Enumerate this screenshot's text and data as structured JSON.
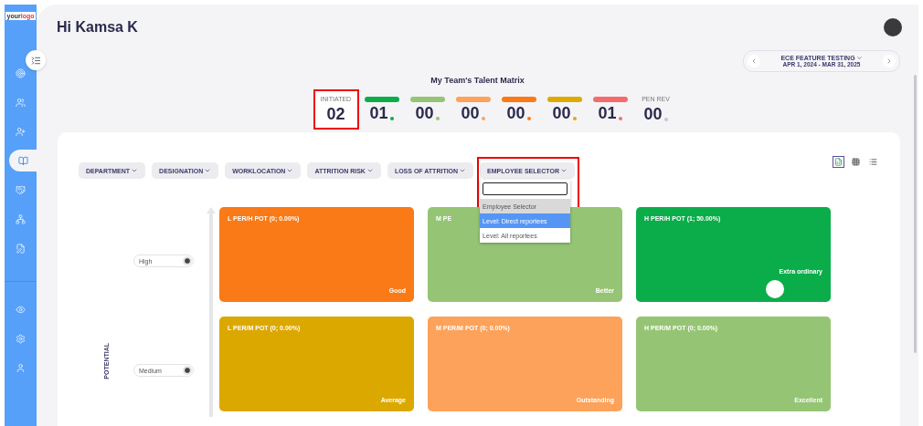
{
  "logo": {
    "first": "your",
    "second": "logo"
  },
  "sidebar": {
    "top_items": [
      {
        "selected": false
      },
      {
        "selected": false
      },
      {
        "selected": false
      },
      {
        "selected": true
      },
      {
        "selected": false
      },
      {
        "selected": false
      },
      {
        "selected": false
      }
    ],
    "bottom_items": [
      {
        "selected": false
      },
      {
        "selected": false
      },
      {
        "selected": false
      }
    ]
  },
  "header": {
    "greeting": "Hi Kamsa K"
  },
  "period": {
    "title": "ECE FEATURE TESTING",
    "dates": "APR 1, 2024 - MAR 31, 2025"
  },
  "matrix_title": "My Team's Talent Matrix",
  "stats": [
    {
      "label": "INITIATED",
      "value": "02",
      "highlighted": true
    },
    {
      "color": "#0bad4a",
      "value": "01",
      "highlighted": false
    },
    {
      "color": "#95c574",
      "value": "00",
      "highlighted": false
    },
    {
      "color": "#fca25a",
      "value": "00",
      "highlighted": false
    },
    {
      "color": "#f97a17",
      "value": "00",
      "highlighted": false
    },
    {
      "color": "#dcaa00",
      "value": "00",
      "highlighted": false
    },
    {
      "color": "#f56b6b",
      "value": "01",
      "highlighted": false
    },
    {
      "label": "PEN REV",
      "color": "#c8c8cc",
      "value": "00",
      "highlighted": false
    }
  ],
  "filters": [
    {
      "label": "DEPARTMENT",
      "expanded": false
    },
    {
      "label": "DESIGNATION",
      "expanded": false
    },
    {
      "label": "WORKLOCATION",
      "expanded": false
    },
    {
      "label": "ATTRITION RISK",
      "expanded": false
    },
    {
      "label": "LOSS OF ATTRITION",
      "expanded": false
    },
    {
      "label": "EMPLOYEE SELECTOR",
      "expanded": true
    }
  ],
  "dropdown": {
    "options": [
      {
        "label": "Employee Selector",
        "selected": false,
        "disabled": true
      },
      {
        "label": "Level: Direct reportees",
        "selected": true,
        "disabled": false
      },
      {
        "label": "Level: All reportees",
        "selected": false,
        "disabled": false
      }
    ]
  },
  "view_options": [
    {
      "selected": true
    },
    {
      "selected": false
    },
    {
      "selected": false
    }
  ],
  "y_axis_label": "POTENTIAL",
  "rows": [
    {
      "level": "High",
      "cells": [
        {
          "title": "L PER/H POT (0; 0.00%)",
          "label": "Good",
          "color": "#f97a17",
          "has_avatar": false
        },
        {
          "title": "M PE",
          "label": "Better",
          "color": "#95c574",
          "has_avatar": false
        },
        {
          "title": "H PER/H POT (1; 50.00%)",
          "label": "Extra ordinary",
          "color": "#0bad4a",
          "has_avatar": true
        }
      ]
    },
    {
      "level": "Medium",
      "cells": [
        {
          "title": "L PER/M POT (0; 0.00%)",
          "label": "Average",
          "color": "#dba800",
          "has_avatar": false
        },
        {
          "title": "M PER/M POT (0; 0.00%)",
          "label": "Outstanding",
          "color": "#fca25a",
          "has_avatar": false
        },
        {
          "title": "H PER/M POT (0; 0.00%)",
          "label": "Excellent",
          "color": "#95c574",
          "has_avatar": false
        }
      ]
    }
  ]
}
